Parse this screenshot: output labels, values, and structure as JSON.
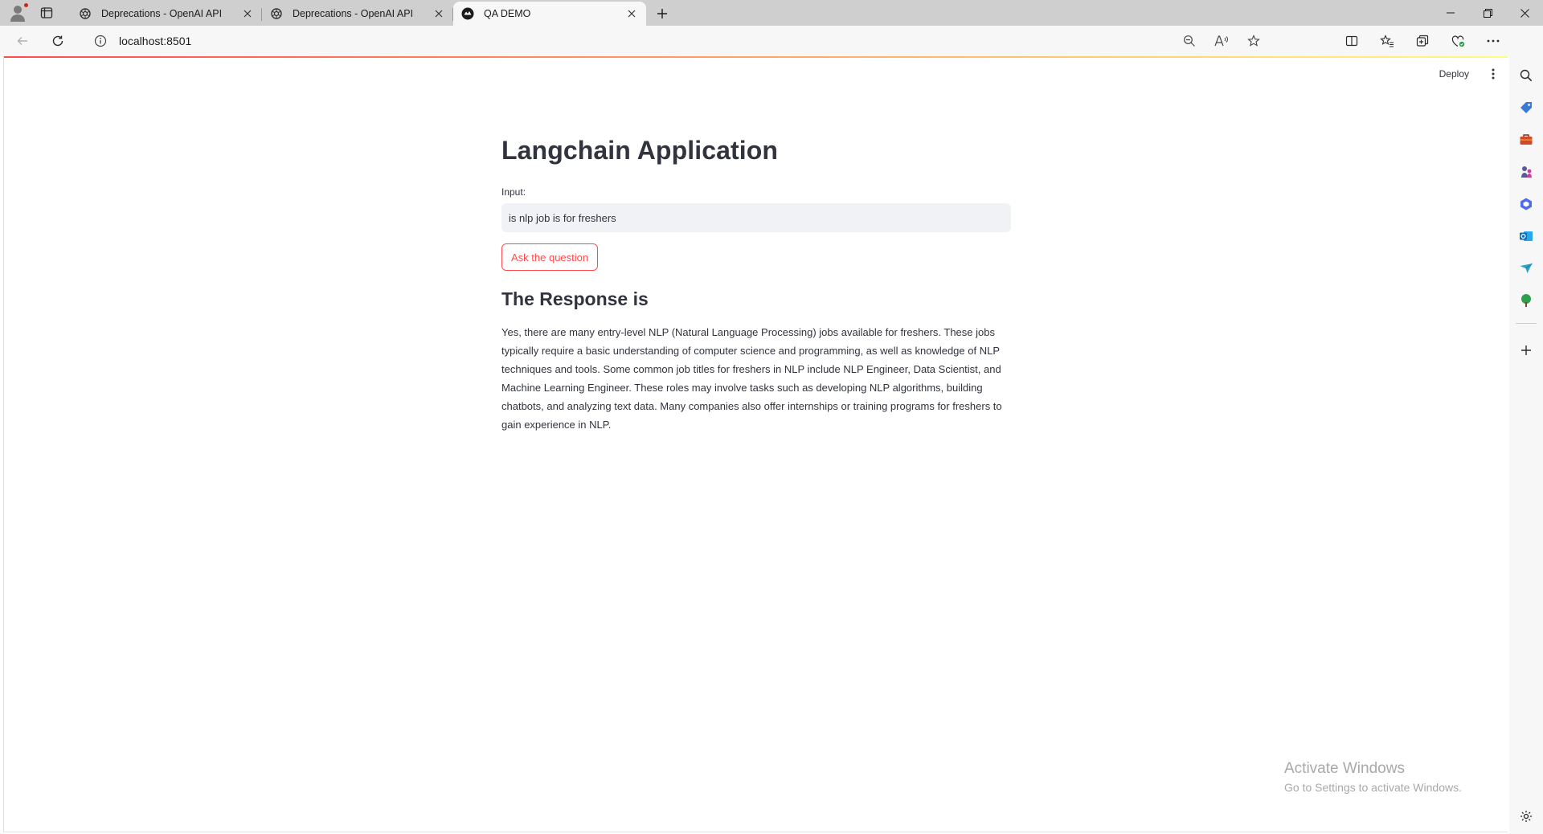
{
  "browser": {
    "tabs": [
      {
        "title": "Deprecations - OpenAI API",
        "favicon": "openai-icon",
        "active": false
      },
      {
        "title": "Deprecations - OpenAI API",
        "favicon": "openai-icon",
        "active": false
      },
      {
        "title": "QA DEMO",
        "favicon": "streamlit-icon",
        "active": true
      }
    ],
    "url": "localhost:8501"
  },
  "app": {
    "deploy_label": "Deploy",
    "title": "Langchain Application",
    "input_label": "Input:",
    "input_value": "is nlp job is for freshers",
    "ask_button": "Ask the question",
    "response_heading": "The Response is",
    "response_text": "Yes, there are many entry-level NLP (Natural Language Processing) jobs available for freshers. These jobs typically require a basic understanding of computer science and programming, as well as knowledge of NLP techniques and tools. Some common job titles for freshers in NLP include NLP Engineer, Data Scientist, and Machine Learning Engineer. These roles may involve tasks such as developing NLP algorithms, building chatbots, and analyzing text data. Many companies also offer internships or training programs for freshers to gain experience in NLP."
  },
  "watermark": {
    "line1": "Activate Windows",
    "line2": "Go to Settings to activate Windows."
  },
  "colors": {
    "accent": "#ff4b4b",
    "input_bg": "#f0f2f6",
    "text": "#31333f"
  }
}
